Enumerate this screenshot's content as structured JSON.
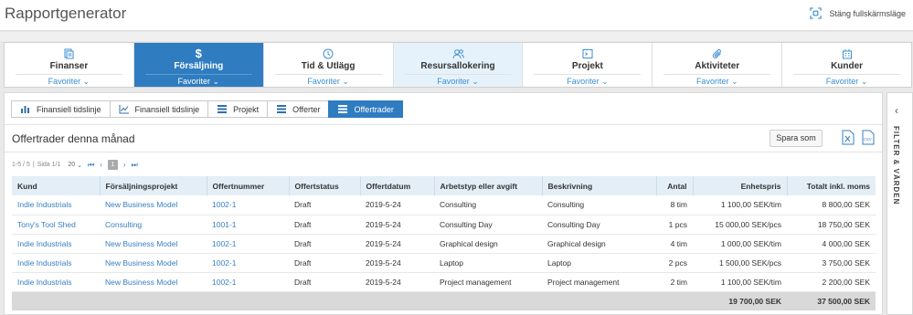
{
  "app": {
    "title": "Rapportgenerator",
    "fullscreen_label": "Stäng fullskärmsläge"
  },
  "module_tabs": [
    {
      "label": "Finanser",
      "sub": "Favoriter",
      "icon": "document-icon"
    },
    {
      "label": "Försäljning",
      "sub": "Favoriter",
      "icon": "dollar-icon"
    },
    {
      "label": "Tid & Utlägg",
      "sub": "Favoriter",
      "icon": "clock-icon"
    },
    {
      "label": "Resursallokering",
      "sub": "Favoriter",
      "icon": "people-icon"
    },
    {
      "label": "Projekt",
      "sub": "Favoriter",
      "icon": "project-icon"
    },
    {
      "label": "Aktiviteter",
      "sub": "Favoriter",
      "icon": "paperclip-icon"
    },
    {
      "label": "Kunder",
      "sub": "Favoriter",
      "icon": "building-icon"
    }
  ],
  "active_module": "Försäljning",
  "view_tabs": [
    {
      "label": "Finansiell tidslinje",
      "icon": "bar-chart-icon"
    },
    {
      "label": "Finansiell tidslinje",
      "icon": "line-chart-icon"
    },
    {
      "label": "Projekt",
      "icon": "list-icon"
    },
    {
      "label": "Offerter",
      "icon": "list-icon"
    },
    {
      "label": "Offertrader",
      "icon": "list-icon"
    }
  ],
  "active_view": "Offertrader",
  "report": {
    "title": "Offertrader denna månad",
    "save_label": "Spara som"
  },
  "pager": {
    "range": "1-5 / 5",
    "page_info": "Sida 1/1",
    "page_size": "20",
    "current_page": "1"
  },
  "table": {
    "headers": [
      "Kund",
      "Försäljningsprojekt",
      "Offertnummer",
      "Offertstatus",
      "Offertdatum",
      "Arbetstyp eller avgift",
      "Beskrivning",
      "Antal",
      "Enhetspris",
      "Totalt inkl. moms"
    ],
    "rows": [
      [
        "Indie Industrials",
        "New Business Model",
        "1002-1",
        "Draft",
        "2019-5-24",
        "Consulting",
        "Consulting",
        "8 tim",
        "1 100,00 SEK/tim",
        "8 800,00 SEK"
      ],
      [
        "Tony's Tool Shed",
        "Consulting",
        "1001-1",
        "Draft",
        "2019-5-24",
        "Consulting Day",
        "Consulting Day",
        "1 pcs",
        "15 000,00 SEK/pcs",
        "18 750,00 SEK"
      ],
      [
        "Indie Industrials",
        "New Business Model",
        "1002-1",
        "Draft",
        "2019-5-24",
        "Graphical design",
        "Graphical design",
        "4 tim",
        "1 000,00 SEK/tim",
        "4 000,00 SEK"
      ],
      [
        "Indie Industrials",
        "New Business Model",
        "1002-1",
        "Draft",
        "2019-5-24",
        "Laptop",
        "Laptop",
        "2 pcs",
        "1 500,00 SEK/pcs",
        "3 750,00 SEK"
      ],
      [
        "Indie Industrials",
        "New Business Model",
        "1002-1",
        "Draft",
        "2019-5-24",
        "Project management",
        "Project management",
        "2 tim",
        "1 100,00 SEK/tim",
        "2 200,00 SEK"
      ]
    ],
    "totals": {
      "unit_price_sum": "19 700,00 SEK",
      "total_sum": "37 500,00 SEK"
    }
  },
  "filter_panel": {
    "label": "FILTER & VÄRDEN"
  },
  "colors": {
    "accent": "#2f7cc0",
    "link": "#3a7fc1",
    "header_bg": "#e4eef7"
  }
}
